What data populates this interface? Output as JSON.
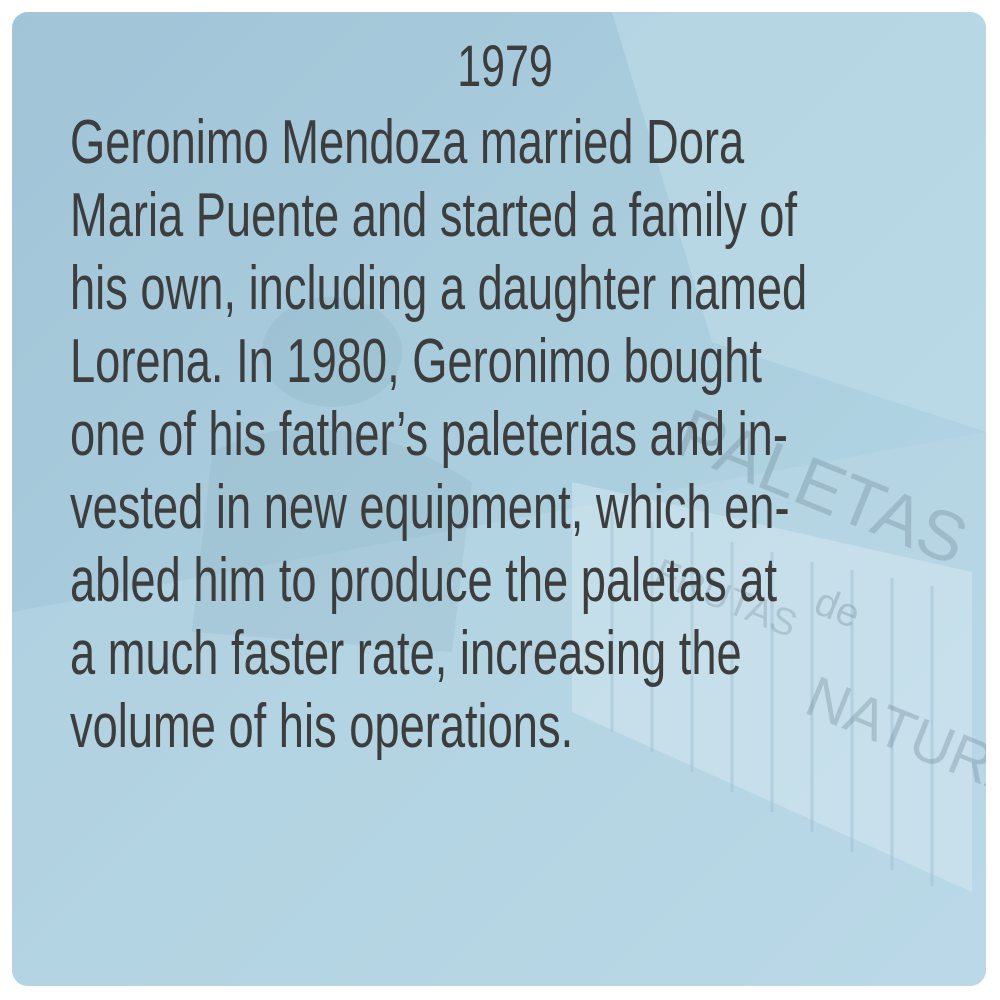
{
  "card": {
    "year": "1979",
    "lines": [
      "Geronimo Mendoza married Dora",
      "Maria Puente and started a family of",
      "his own, including a daughter named",
      "Lorena. In 1980, Geronimo bought",
      "one of his father’s paleterias and in-",
      "vested in new equipment, which en-",
      "abled him to produce the paletas at",
      "a much faster rate, increasing the",
      "volume of his operations."
    ]
  },
  "background": {
    "tint_color": "#a9cddd",
    "text_color": "#3d3d3d",
    "photo_sign_lines": [
      "PALETAS",
      "de",
      "FRUTAS",
      "NATURALES"
    ]
  }
}
